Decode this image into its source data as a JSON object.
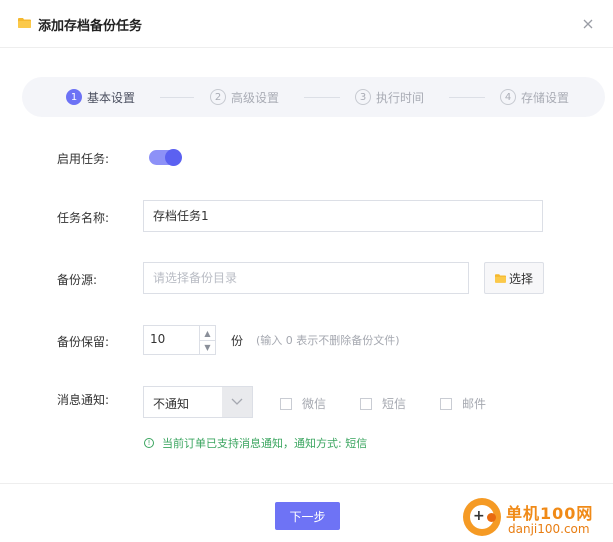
{
  "dialog": {
    "title": "添加存档备份任务",
    "close_glyph": "×"
  },
  "steps": [
    {
      "num": "1",
      "label": "基本设置",
      "active": true
    },
    {
      "num": "2",
      "label": "高级设置",
      "active": false
    },
    {
      "num": "3",
      "label": "执行时间",
      "active": false
    },
    {
      "num": "4",
      "label": "存储设置",
      "active": false
    }
  ],
  "form": {
    "enable_label": "启用任务:",
    "enable_on": true,
    "name_label": "任务名称:",
    "name_value": "存档任务1",
    "source_label": "备份源:",
    "source_placeholder": "请选择备份目录",
    "select_button": "选择",
    "retain_label": "备份保留:",
    "retain_value": "10",
    "retain_unit": "份",
    "retain_hint": "(输入 0 表示不删除备份文件)",
    "notify_label": "消息通知:",
    "notify_selected": "不通知",
    "notify_options": [
      "微信",
      "短信",
      "邮件"
    ],
    "notice_text": "当前订单已支持消息通知，通知方式:  短信"
  },
  "footer": {
    "next_button": "下一步"
  },
  "watermark": {
    "cn": "单机100网",
    "url": "danji100.com"
  },
  "colors": {
    "accent": "#6e73f5",
    "success": "#3aa55f",
    "folder": "#f5b82e"
  }
}
